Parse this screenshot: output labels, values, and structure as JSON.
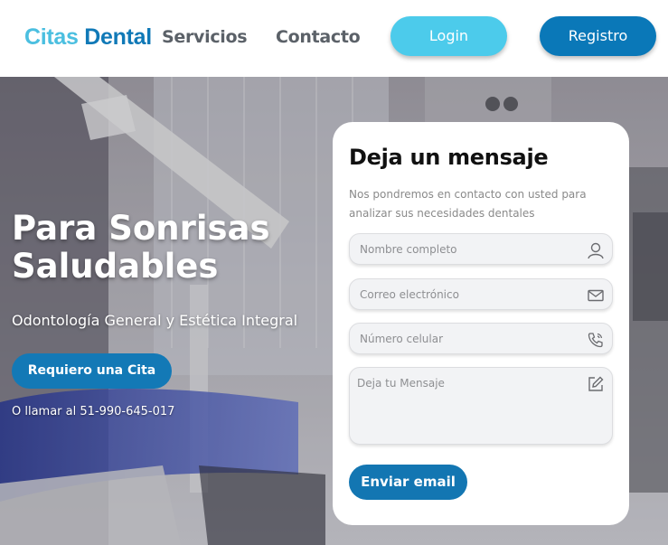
{
  "header": {
    "logo_part1": "Citas",
    "logo_part2": "Dental",
    "nav": {
      "servicios": "Servicios",
      "contacto": "Contacto"
    },
    "login_label": "Login",
    "registro_label": "Registro"
  },
  "hero": {
    "title": "Para Sonrisas Saludables",
    "subtitle": "Odontología General y Estética Integral",
    "cta_label": "Requiero una Cita",
    "phone_text": "O llamar al 51-990-645-017"
  },
  "contact_form": {
    "title": "Deja un mensaje",
    "description": "Nos pondremos en contacto con usted para analizar sus necesidades dentales",
    "fields": {
      "name_placeholder": "Nombre completo",
      "email_placeholder": "Correo electrónico",
      "phone_placeholder": "Número celular",
      "message_placeholder": "Deja tu Mensaje"
    },
    "submit_label": "Enviar email"
  },
  "colors": {
    "brand_light": "#4bbfe0",
    "brand_dark": "#1079b7",
    "login_button": "#4ccbeb",
    "primary_button": "#0a78b8"
  },
  "icons": {
    "name_field": "user-icon",
    "email_field": "envelope-icon",
    "phone_field": "phone-icon",
    "message_field": "edit-icon"
  }
}
